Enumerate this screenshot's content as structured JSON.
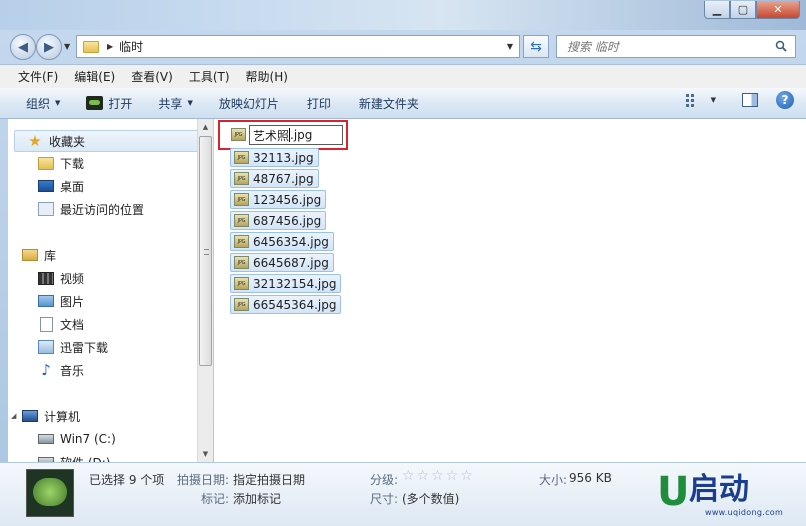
{
  "address": {
    "path": "临时",
    "search_placeholder": "搜索 临时"
  },
  "menubar": [
    "文件(F)",
    "编辑(E)",
    "查看(V)",
    "工具(T)",
    "帮助(H)"
  ],
  "commandbar": {
    "organize": "组织",
    "open": "打开",
    "share": "共享",
    "slideshow": "放映幻灯片",
    "print": "打印",
    "new_folder": "新建文件夹"
  },
  "navpane": {
    "favorites": "收藏夹",
    "downloads": "下载",
    "desktop": "桌面",
    "recent": "最近访问的位置",
    "libraries": "库",
    "videos": "视频",
    "pictures": "图片",
    "documents": "文档",
    "thunder": "迅雷下载",
    "music": "音乐",
    "computer": "计算机",
    "drive_c": "Win7 (C:)",
    "drive_d": "软件 (D:)"
  },
  "files": {
    "rename_value": "艺术照",
    "rename_ext": ".jpg",
    "icon_label": "JPG",
    "items": [
      "32113.jpg",
      "48767.jpg",
      "123456.jpg",
      "687456.jpg",
      "6456354.jpg",
      "6645687.jpg",
      "32132154.jpg",
      "66545364.jpg"
    ]
  },
  "details": {
    "selected": "已选择 9 个项",
    "date_taken_label": "拍摄日期:",
    "date_taken_value": "指定拍摄日期",
    "tags_label": "标记:",
    "tags_value": "添加标记",
    "rating_label": "分级:",
    "dimensions_label": "尺寸:",
    "dimensions_value": "(多个数值)",
    "size_label": "大小:",
    "size_value": "956 KB"
  },
  "logo": {
    "u": "U",
    "name": "启动",
    "url": "www.uqidong.com"
  },
  "colors": {
    "highlight_box": "#d9232f",
    "selection": "#d3e5f8",
    "logo_green": "#1f8d3c",
    "logo_blue": "#1a3d8f"
  }
}
